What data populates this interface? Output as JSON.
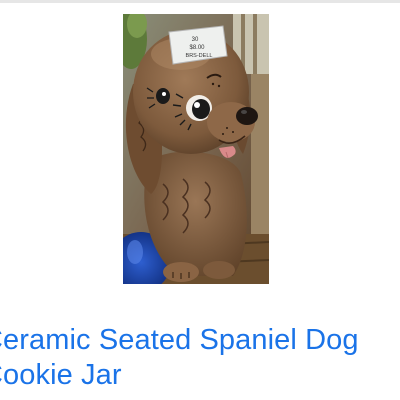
{
  "product": {
    "title_line_1": "Ceramic Seated Spaniel Dog",
    "title_line_2": "Cookie Jar",
    "image_alt": "Ceramic seated spaniel dog cookie jar",
    "tag_text_line_1": "30",
    "tag_text_line_2": "$8.00",
    "tag_text_line_3": "BRS-DELL"
  },
  "colors": {
    "link_blue": "#1a73e8",
    "border": "#e6e6e6"
  }
}
